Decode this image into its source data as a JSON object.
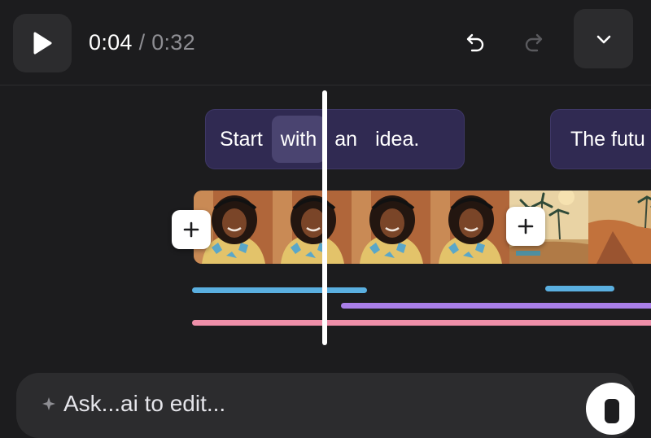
{
  "player": {
    "current_time": "0:04",
    "separator": "/",
    "total_time": "0:32"
  },
  "icons": {
    "play": "play-icon",
    "undo": "undo-icon",
    "redo": "redo-icon",
    "collapse": "chevron-down-icon",
    "add": "plus-icon",
    "mic": "mic-icon"
  },
  "captions": [
    {
      "words": [
        "Start",
        "with",
        "an",
        "idea."
      ],
      "active_word": "with"
    },
    {
      "words": [
        "The futu"
      ]
    }
  ],
  "timeline": {
    "clips": [
      {
        "subject": "woman-with-headphones",
        "frames": 4
      },
      {
        "subject": "desert-palms",
        "frames": 2
      }
    ],
    "tracks": [
      {
        "name": "blue",
        "color": "#5aafe0"
      },
      {
        "name": "purple",
        "color": "#a97ee8"
      },
      {
        "name": "pink",
        "color": "#ee8fa9"
      }
    ]
  },
  "prompt": {
    "placeholder": "Ask...ai to edit..."
  },
  "colors": {
    "background": "#1c1c1e",
    "button_bg": "#2c2c2e",
    "caption_bg": "#302a52",
    "caption_active": "#4a4470",
    "muted_text": "#8e8e93"
  }
}
